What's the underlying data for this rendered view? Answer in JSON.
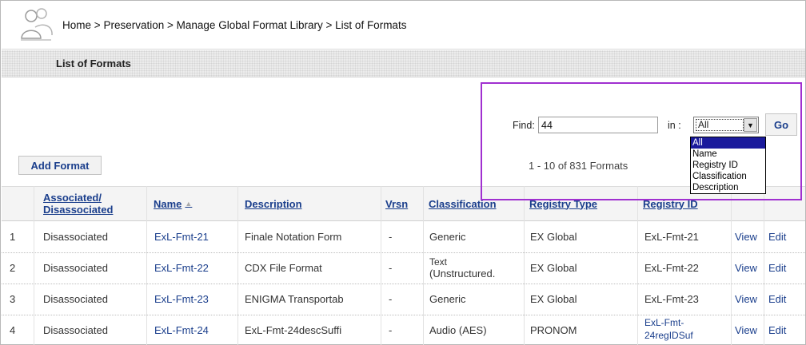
{
  "breadcrumb": [
    "Home",
    "Preservation",
    "Manage Global Format Library",
    "List of Formats"
  ],
  "breadcrumb_separator": ">",
  "page_title": "List of Formats",
  "search": {
    "find_label": "Find:",
    "find_value": "44",
    "in_label": "in :",
    "selected": "All",
    "options": [
      "All",
      "Name",
      "Registry ID",
      "Classification",
      "Description"
    ],
    "go_label": "Go"
  },
  "add_format_label": "Add Format",
  "result_count": "1 - 10 of 831 Formats",
  "table": {
    "headers": {
      "assoc_line1": "Associated/",
      "assoc_line2": "Disassociated",
      "name": "Name",
      "description": "Description",
      "version": "Vrsn",
      "classification": "Classification",
      "registry_type": "Registry Type",
      "registry_id": "Registry ID"
    },
    "rows": [
      {
        "num": "1",
        "assoc": "Disassociated",
        "name": "ExL-Fmt-21",
        "description": "Finale Notation Form",
        "version": "-",
        "class1": "Generic",
        "class2": "",
        "reg_type": "EX Global",
        "reg_id1": "ExL-Fmt-21",
        "reg_id2": "",
        "view": "View",
        "edit": "Edit"
      },
      {
        "num": "2",
        "assoc": "Disassociated",
        "name": "ExL-Fmt-22",
        "description": "CDX File Format",
        "version": "-",
        "class1": "Text",
        "class2": "(Unstructured.",
        "reg_type": "EX Global",
        "reg_id1": "ExL-Fmt-22",
        "reg_id2": "",
        "view": "View",
        "edit": "Edit"
      },
      {
        "num": "3",
        "assoc": "Disassociated",
        "name": "ExL-Fmt-23",
        "description": "ENIGMA Transportab",
        "version": "-",
        "class1": "Generic",
        "class2": "",
        "reg_type": "EX Global",
        "reg_id1": "ExL-Fmt-23",
        "reg_id2": "",
        "view": "View",
        "edit": "Edit"
      },
      {
        "num": "4",
        "assoc": "Disassociated",
        "name": "ExL-Fmt-24",
        "description": "ExL-Fmt-24descSuffi",
        "version": "-",
        "class1": "Audio (AES)",
        "class2": "",
        "reg_type": "PRONOM",
        "reg_id1": "ExL-Fmt-",
        "reg_id2": "24regIDSuf",
        "view": "View",
        "edit": "Edit"
      }
    ]
  },
  "colors": {
    "link": "#1a3e8c",
    "highlight": "#a030d0",
    "header_bg": "#f4f4f4"
  }
}
